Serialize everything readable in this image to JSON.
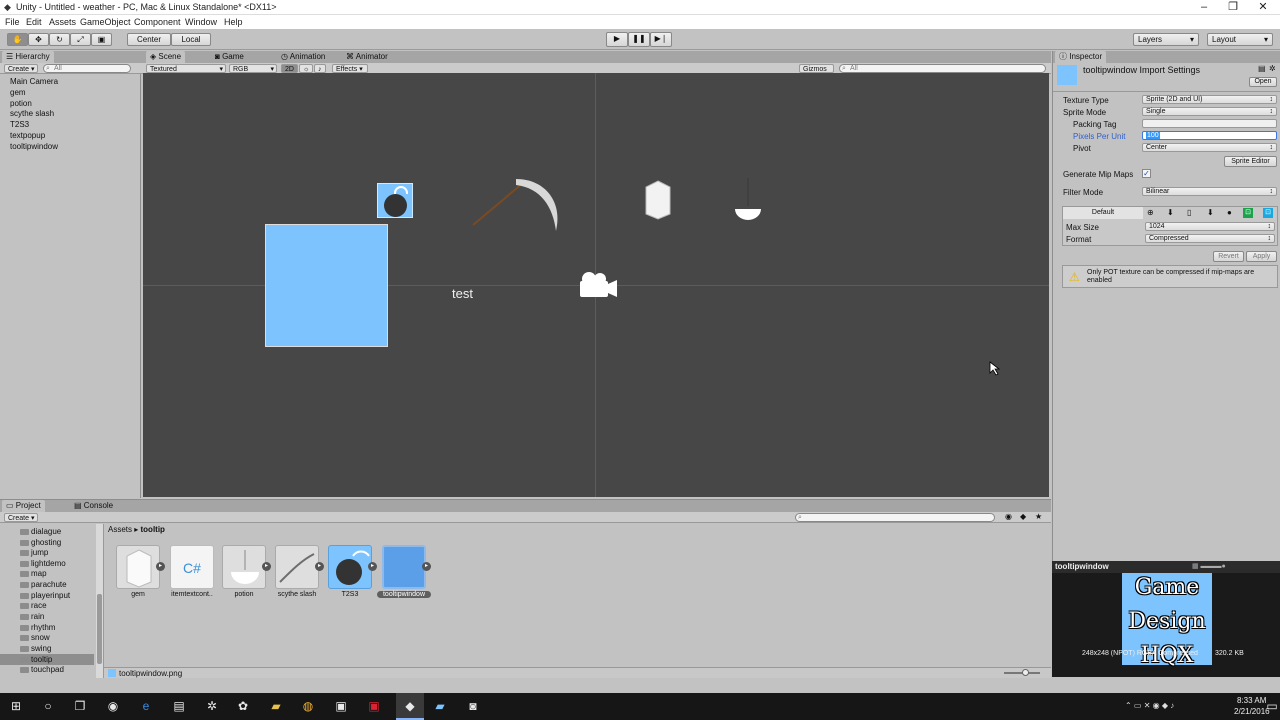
{
  "window": {
    "title": "Unity - Untitled - weather - PC, Mac & Linux Standalone* <DX11>"
  },
  "menu": [
    "File",
    "Edit",
    "Assets",
    "GameObject",
    "Component",
    "Window",
    "Help"
  ],
  "toolbar": {
    "pivot": "Center",
    "space": "Local",
    "layers": "Layers",
    "layout": "Layout"
  },
  "hierarchy": {
    "tab": "Hierarchy",
    "create": "Create",
    "search": "All",
    "items": [
      "Main Camera",
      "gem",
      "potion",
      "scythe slash",
      "T2S3",
      "textpopup",
      "tooltipwindow"
    ]
  },
  "scene": {
    "tabs": [
      "Scene",
      "Game",
      "Animation",
      "Animator"
    ],
    "shading": "Textured",
    "channel": "RGB",
    "mode2d": "2D",
    "effects": "Effects",
    "gizmos": "Gizmos",
    "search": "All",
    "test_label": "test"
  },
  "inspector": {
    "tab": "Inspector",
    "title": "tooltipwindow Import Settings",
    "open": "Open",
    "texture_type_label": "Texture Type",
    "texture_type": "Sprite (2D and UI)",
    "sprite_mode_label": "Sprite Mode",
    "sprite_mode": "Single",
    "packing_tag_label": "Packing Tag",
    "packing_tag": "",
    "ppu_label": "Pixels Per Unit",
    "ppu": "100",
    "pivot_label": "Pivot",
    "pivot": "Center",
    "sprite_editor": "Sprite Editor",
    "mipmaps_label": "Generate Mip Maps",
    "mipmaps_checked": true,
    "filter_label": "Filter Mode",
    "filter": "Bilinear",
    "platform_default": "Default",
    "max_size_label": "Max Size",
    "max_size": "1024",
    "format_label": "Format",
    "format": "Compressed",
    "revert": "Revert",
    "apply": "Apply",
    "warning": "Only POT texture can be compressed if mip-maps are enabled"
  },
  "project": {
    "tabs": [
      "Project",
      "Console"
    ],
    "create": "Create",
    "folders": [
      "dialague",
      "ghosting",
      "jump",
      "lightdemo",
      "map",
      "parachute",
      "playerinput",
      "race",
      "rain",
      "rhythm",
      "snow",
      "swing",
      "tooltip",
      "touchpad"
    ],
    "selected_folder": "tooltip",
    "breadcrumb_root": "Assets",
    "breadcrumb_leaf": "tooltip",
    "assets": [
      "gem",
      "itemtextcont..",
      "potion",
      "scythe slash",
      "T2S3",
      "tooltipwindow"
    ],
    "selected_asset": "tooltipwindow",
    "status_file": "tooltipwindow.png"
  },
  "preview": {
    "title": "tooltipwindow",
    "size": "248x248 (NPOT) RGBA Compressed DXT5",
    "bytes": "320.2 KB",
    "watermark": [
      "Game",
      "Design",
      "HQX"
    ]
  },
  "taskbar": {
    "time": "8:33 AM",
    "date": "2/21/2016"
  },
  "colors": {
    "sprite_blue": "#7dc4ff",
    "viewport": "#474747",
    "panel": "#c2c2c2"
  }
}
